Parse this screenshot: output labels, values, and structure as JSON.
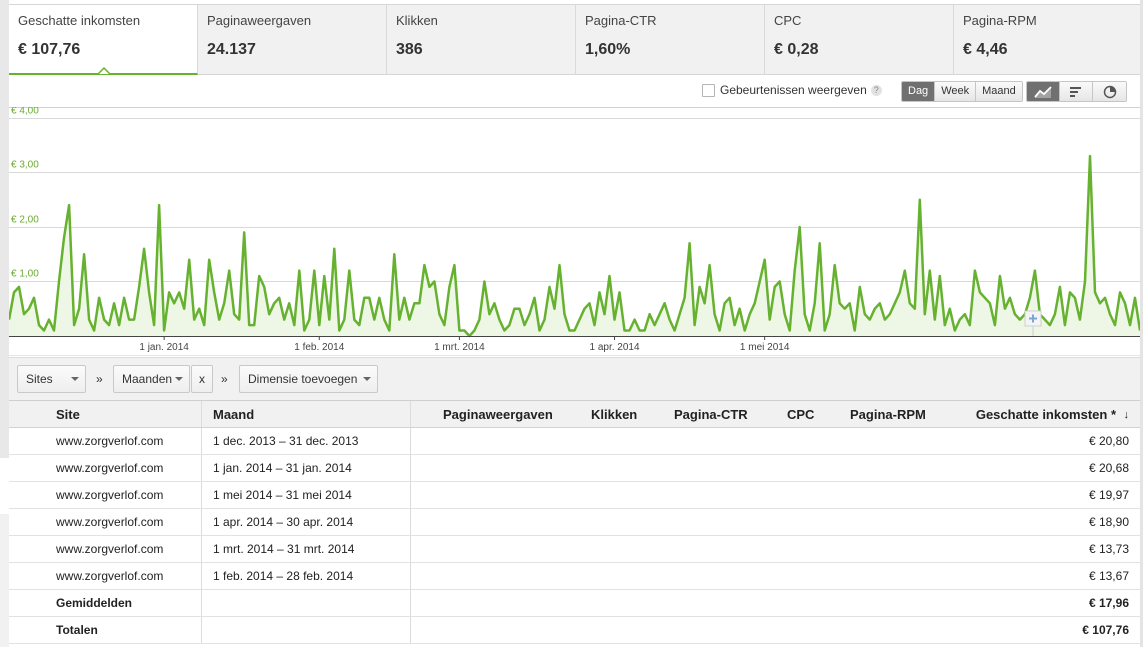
{
  "metrics": [
    {
      "label": "Geschatte inkomsten",
      "value": "€ 107,76",
      "active": true
    },
    {
      "label": "Paginaweergaven",
      "value": "24.137"
    },
    {
      "label": "Klikken",
      "value": "386"
    },
    {
      "label": "Pagina-CTR",
      "value": "1,60%"
    },
    {
      "label": "CPC",
      "value": "€ 0,28"
    },
    {
      "label": "Pagina-RPM",
      "value": "€ 4,46"
    }
  ],
  "toolbar": {
    "events_label": "Gebeurtenissen weergeven",
    "help_glyph": "?",
    "granularity": [
      "Dag",
      "Week",
      "Maand"
    ],
    "granularity_selected": "Dag",
    "chart_types": [
      "line-chart-icon",
      "bar-chart-icon",
      "pie-chart-icon"
    ]
  },
  "chart_data": {
    "type": "area",
    "ylabel_ticks": [
      "€ 4,00",
      "€ 3,00",
      "€ 2,00",
      "€ 1,00"
    ],
    "ylim": [
      0,
      4.2
    ],
    "x_ticks": [
      {
        "label": "1 jan. 2014",
        "index": 31
      },
      {
        "label": "1 feb. 2014",
        "index": 62
      },
      {
        "label": "1 mrt. 2014",
        "index": 90
      },
      {
        "label": "1 apr. 2014",
        "index": 121
      },
      {
        "label": "1 mei 2014",
        "index": 151
      }
    ],
    "grid": true,
    "color": "#66b230",
    "series": [
      {
        "values": [
          0.3,
          0.8,
          0.9,
          0.4,
          0.5,
          0.7,
          0.2,
          0.1,
          0.3,
          0.1,
          1.0,
          1.8,
          2.4,
          0.2,
          0.5,
          1.5,
          0.3,
          0.1,
          0.7,
          0.3,
          0.2,
          0.6,
          0.2,
          0.7,
          0.3,
          0.3,
          0.9,
          1.6,
          0.8,
          0.2,
          2.4,
          0.1,
          0.8,
          0.6,
          0.8,
          0.5,
          1.4,
          0.3,
          0.5,
          0.2,
          1.4,
          0.8,
          0.3,
          0.6,
          1.2,
          0.4,
          0.3,
          1.9,
          0.2,
          0.2,
          1.1,
          0.9,
          0.4,
          0.6,
          0.7,
          0.3,
          0.6,
          0.2,
          1.2,
          0.1,
          0.3,
          1.2,
          0.2,
          1.1,
          0.3,
          1.6,
          0.1,
          0.3,
          1.2,
          0.3,
          0.2,
          0.7,
          0.7,
          0.3,
          0.7,
          0.3,
          0.1,
          1.5,
          0.3,
          0.7,
          0.3,
          0.6,
          0.6,
          1.3,
          0.9,
          1.0,
          0.4,
          0.2,
          0.9,
          1.3,
          0.1,
          0.1,
          0.0,
          0.1,
          0.3,
          1.0,
          0.4,
          0.6,
          0.3,
          0.1,
          0.2,
          0.5,
          0.5,
          0.2,
          0.4,
          0.7,
          0.1,
          0.3,
          0.9,
          0.5,
          1.3,
          0.4,
          0.1,
          0.1,
          0.3,
          0.5,
          0.6,
          0.2,
          0.8,
          0.4,
          1.1,
          0.3,
          0.8,
          0.1,
          0.1,
          0.3,
          0.1,
          0.1,
          0.4,
          0.2,
          0.4,
          0.6,
          0.3,
          0.1,
          0.4,
          0.7,
          1.7,
          0.2,
          0.9,
          0.6,
          1.3,
          0.4,
          0.1,
          0.6,
          0.7,
          0.2,
          0.5,
          0.1,
          0.4,
          0.6,
          1.0,
          1.4,
          0.3,
          0.9,
          1.0,
          0.4,
          0.1,
          1.2,
          2.0,
          0.4,
          0.1,
          0.6,
          1.7,
          0.1,
          0.4,
          1.3,
          0.6,
          0.5,
          0.6,
          0.1,
          0.9,
          0.4,
          0.3,
          0.5,
          0.6,
          0.3,
          0.4,
          0.6,
          0.8,
          1.2,
          0.6,
          0.5,
          2.5,
          0.4,
          1.2,
          0.3,
          1.1,
          0.2,
          0.5,
          0.1,
          0.3,
          0.4,
          0.2,
          1.2,
          0.8,
          0.7,
          0.6,
          0.2,
          1.1,
          0.5,
          0.7,
          0.4,
          0.3,
          0.4,
          0.7,
          1.2,
          0.4,
          0.3,
          0.2,
          0.4,
          0.9,
          0.2,
          0.8,
          0.7,
          0.3,
          1.0,
          3.3,
          0.8,
          0.6,
          0.7,
          0.4,
          0.2,
          0.8,
          0.6,
          0.2,
          0.7,
          0.1
        ]
      }
    ]
  },
  "dimension_bar": {
    "sites_label": "Sites",
    "separator": "»",
    "months_label": "Maanden",
    "remove_label": "x",
    "add_dimension_label": "Dimensie toevoegen"
  },
  "table": {
    "columns": {
      "site": "Site",
      "month": "Maand",
      "pageviews": "Paginaweergaven",
      "clicks": "Klikken",
      "ctr": "Pagina-CTR",
      "cpc": "CPC",
      "rpm": "Pagina-RPM",
      "earnings": "Geschatte inkomsten *",
      "sort_glyph": "↓"
    },
    "rows": [
      {
        "site": "www.zorgverlof.com",
        "month": "1 dec. 2013 – 31 dec. 2013",
        "earnings": "€ 20,80"
      },
      {
        "site": "www.zorgverlof.com",
        "month": "1 jan. 2014 – 31 jan. 2014",
        "earnings": "€ 20,68"
      },
      {
        "site": "www.zorgverlof.com",
        "month": "1 mei 2014 – 31 mei 2014",
        "earnings": "€ 19,97"
      },
      {
        "site": "www.zorgverlof.com",
        "month": "1 apr. 2014 – 30 apr. 2014",
        "earnings": "€ 18,90"
      },
      {
        "site": "www.zorgverlof.com",
        "month": "1 mrt. 2014 – 31 mrt. 2014",
        "earnings": "€ 13,73"
      },
      {
        "site": "www.zorgverlof.com",
        "month": "1 feb. 2014 – 28 feb. 2014",
        "earnings": "€ 13,67"
      }
    ],
    "averages": {
      "label": "Gemiddelden",
      "earnings": "€ 17,96"
    },
    "totals": {
      "label": "Totalen",
      "earnings": "€ 107,76"
    }
  }
}
